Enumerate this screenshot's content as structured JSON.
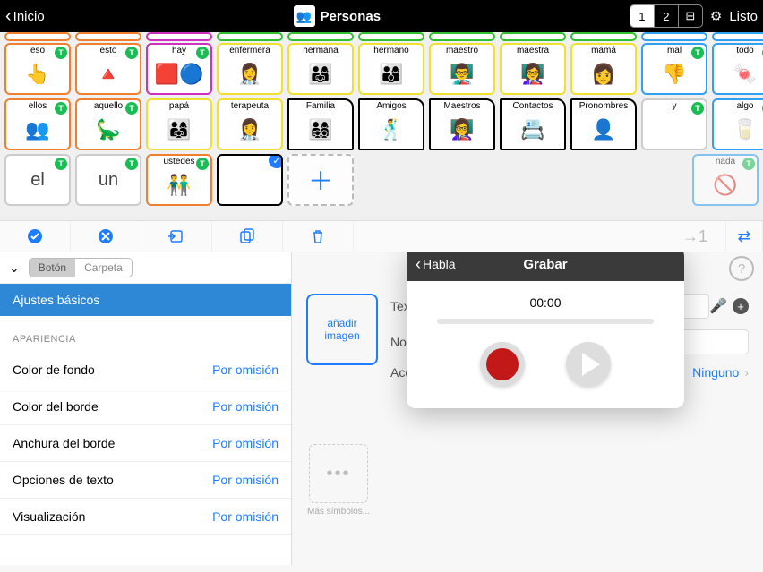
{
  "topbar": {
    "back": "Inicio",
    "title": "Personas",
    "pages": [
      "1",
      "2"
    ],
    "done": "Listo"
  },
  "board": {
    "row1_peekers": 11,
    "row2": [
      {
        "label": "eso",
        "border": "#f08030",
        "badge": true,
        "emoji": "👆"
      },
      {
        "label": "esto",
        "border": "#f08030",
        "badge": true,
        "emoji": "🔺"
      },
      {
        "label": "hay",
        "border": "#d030c0",
        "badge": true,
        "emoji": "🟥🔵"
      },
      {
        "label": "enfermera",
        "border": "#f0e030",
        "badge": false,
        "emoji": "👩‍⚕️"
      },
      {
        "label": "hermana",
        "border": "#f0e030",
        "badge": false,
        "emoji": "👨‍👩‍👧"
      },
      {
        "label": "hermano",
        "border": "#f0e030",
        "badge": false,
        "emoji": "👨‍👩‍👦"
      },
      {
        "label": "maestro",
        "border": "#f0e030",
        "badge": false,
        "emoji": "👨‍🏫"
      },
      {
        "label": "maestra",
        "border": "#f0e030",
        "badge": false,
        "emoji": "👩‍🏫"
      },
      {
        "label": "mamá",
        "border": "#f0e030",
        "badge": false,
        "emoji": "👩"
      },
      {
        "label": "mal",
        "border": "#30a0f0",
        "badge": true,
        "emoji": "👎"
      },
      {
        "label": "todo",
        "border": "#30a0f0",
        "badge": true,
        "emoji": "🍬"
      }
    ],
    "row3": [
      {
        "label": "ellos",
        "border": "#f08030",
        "badge": true,
        "emoji": "👥"
      },
      {
        "label": "aquello",
        "border": "#f08030",
        "badge": true,
        "emoji": "🦕"
      },
      {
        "label": "papá",
        "border": "#f0e030",
        "badge": false,
        "emoji": "👨‍👩‍👧"
      },
      {
        "label": "terapeuta",
        "border": "#f0e030",
        "badge": false,
        "emoji": "👩‍⚕️"
      },
      {
        "label": "Familia",
        "border": "#000",
        "folder": true,
        "emoji": "👨‍👩‍👧‍👦"
      },
      {
        "label": "Amigos",
        "border": "#000",
        "folder": true,
        "emoji": "🕺"
      },
      {
        "label": "Maestros",
        "border": "#000",
        "folder": true,
        "emoji": "👩‍🏫"
      },
      {
        "label": "Contactos",
        "border": "#000",
        "folder": true,
        "emoji": "📇"
      },
      {
        "label": "Pronombres",
        "border": "#000",
        "folder": true,
        "emoji": "👤"
      },
      {
        "label": "y",
        "border": "#ccc",
        "badge": true,
        "emoji": " "
      },
      {
        "label": "algo",
        "border": "#30a0f0",
        "badge": true,
        "emoji": "🥛"
      }
    ],
    "row4": [
      {
        "label": "el",
        "border": "#ccc",
        "badge": true,
        "bigtext": true
      },
      {
        "label": "un",
        "border": "#ccc",
        "badge": true,
        "bigtext": true
      },
      {
        "label": "ustedes",
        "border": "#f08030",
        "badge": true,
        "emoji": "👬"
      },
      {
        "label": "",
        "border": "#000",
        "selected": true
      },
      {
        "label": "",
        "border": "#ccc",
        "dash": true,
        "plus": true
      }
    ],
    "row4_last": {
      "label": "nada",
      "border": "#30a0f0",
      "badge": true,
      "emoji": "🚫",
      "dim": true
    }
  },
  "toolbar": {
    "items": [
      "check",
      "uncheck",
      "import",
      "copy",
      "trash",
      "to1"
    ]
  },
  "settings": {
    "seg": {
      "a": "Botón",
      "b": "Carpeta"
    },
    "header": "Ajustes básicos",
    "group": "APARIENCIA",
    "rows": [
      {
        "k": "Color de fondo",
        "v": "Por omisión"
      },
      {
        "k": "Color del borde",
        "v": "Por omisión"
      },
      {
        "k": "Anchura del borde",
        "v": "Por omisión"
      },
      {
        "k": "Opciones de texto",
        "v": "Por omisión"
      },
      {
        "k": "Visualización",
        "v": "Por omisión"
      }
    ]
  },
  "editor": {
    "addImage": "añadir imagen",
    "textLabel": "Texto",
    "nameLabel": "Nombre",
    "actionsLabel": "Acciones",
    "actionsValue": "Ninguno",
    "moreSymbols": "Más símbolos..."
  },
  "popover": {
    "back": "Habla",
    "title": "Grabar",
    "time": "00:00"
  },
  "chart_data": null
}
